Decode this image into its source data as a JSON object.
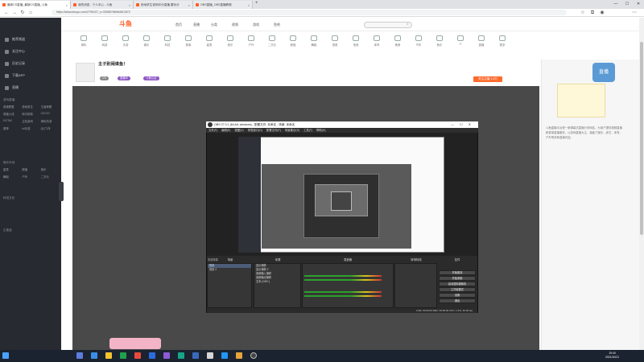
{
  "browser": {
    "tabs": [
      {
        "label": "最新CS直播_最新CS直播_斗鱼",
        "color": "#ff5d23"
      },
      {
        "label": "我的消息 - 个人中心 - 斗鱼",
        "color": "#ff5d23"
      },
      {
        "label": "绝地求生官网冲分直播 要玩分",
        "color": "#ff5d23"
      },
      {
        "label": "OBS直播_OBS直播教程",
        "color": "#ff5d23"
      }
    ],
    "url": "https://www.douyu.com/2795107_s=33085786084812872",
    "window_controls": [
      "—",
      "☐",
      "✕"
    ]
  },
  "site": {
    "logo": "斗鱼",
    "nav": [
      "首页",
      "直播",
      "分类",
      "视频",
      "游戏",
      "鱼吧"
    ],
    "categories": [
      "单机",
      "网游",
      "手游",
      "娱乐",
      "科技",
      "赛事",
      "星秀",
      "音乐",
      "户外",
      "二次元",
      "颜值",
      "舞蹈",
      "语音",
      "电竞",
      "体育",
      "美食",
      "汽车",
      "鱼乐",
      "Ti",
      "直播",
      "更多"
    ]
  },
  "sidebar": {
    "items": [
      "推荐频道",
      "关注中心",
      "历史记录",
      "下载APP",
      "直播"
    ],
    "sections": [
      "游戏直播",
      "娱乐天地",
      "科技文化",
      "正能量"
    ],
    "grid": [
      "英雄联盟",
      "绝地求生",
      "王者荣耀",
      "穿越火线",
      "和平精英",
      "CS:GO",
      "DOTA2",
      "主机游戏",
      "单机热游",
      "原神",
      "lol手游",
      "QQ飞车",
      "星秀",
      "颜值",
      "音乐",
      "舞蹈",
      "户外",
      "二次元"
    ]
  },
  "room": {
    "title": "主子别闹谁鱼！",
    "follow_label": "关注主播 1.8万",
    "tags": [
      "CS",
      "直播中",
      "斗鱼认证"
    ]
  },
  "obs": {
    "title": "OBS 27.0.1 (64-bit, windows) - 配置文件: 未命名 - 场景: 未命名",
    "menu": [
      "文件(F)",
      "编辑(E)",
      "视图(V)",
      "停靠窗口(D)",
      "配置文件(P)",
      "场景集合(S)",
      "工具(T)",
      "帮助(H)"
    ],
    "panels": {
      "scenes": "场景",
      "sources": "来源",
      "mixer": "混音器",
      "transitions": "转场特效",
      "controls": "控件"
    },
    "scene_items": [
      "场景",
      "场景 2"
    ],
    "source_items": [
      "显示捕获",
      "显示捕获 2",
      "音频输入捕获",
      "音频输出捕获",
      "文本 (GDI+)"
    ],
    "controls": [
      "开始推流",
      "开始录制",
      "启动虚拟摄像机",
      "工作室模式",
      "设置",
      "退出"
    ],
    "status": "LIVE: 00:00:00   REC: 00:00:00   CPU: 1.4%, 30.00 fps",
    "no_source": "未选择源"
  },
  "right_panel": {
    "badge": "直播",
    "text": "斗鱼直播平台是一家弹幕式直播分享网站，为用户提供视频直播和赛事直播服务，以游戏直播为主，涵盖了娱乐、综艺、体育、户外等多种直播内容。"
  },
  "taskbar": {
    "time": "19:40",
    "date": "2021/10/21"
  }
}
